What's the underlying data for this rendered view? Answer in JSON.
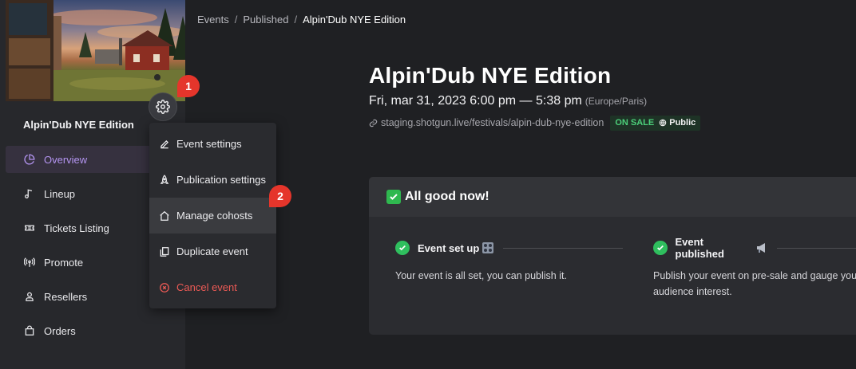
{
  "breadcrumb": {
    "items": [
      "Events",
      "Published"
    ],
    "separator": "/",
    "current": "Alpin'Dub NYE Edition"
  },
  "event": {
    "name": "Alpin'Dub NYE Edition",
    "title": "Alpin'Dub NYE Edition",
    "date": "Fri, mar 31, 2023 6:00 pm — 5:38 pm",
    "timezone": "(Europe/Paris)",
    "url": "staging.shotgun.live/festivals/alpin-dub-nye-edition",
    "status_label": "ON SALE",
    "visibility_label": "Public"
  },
  "sidebar": {
    "items": [
      {
        "label": "Overview",
        "icon": "pie-chart-icon",
        "active": true
      },
      {
        "label": "Lineup",
        "icon": "music-note-icon"
      },
      {
        "label": "Tickets Listing",
        "icon": "ticket-icon"
      },
      {
        "label": "Promote",
        "icon": "broadcast-icon"
      },
      {
        "label": "Resellers",
        "icon": "person-badge-icon"
      },
      {
        "label": "Orders",
        "icon": "shopping-bag-icon"
      }
    ]
  },
  "menu": {
    "items": [
      {
        "label": "Event settings",
        "icon": "pencil-icon"
      },
      {
        "label": "Publication settings",
        "icon": "rocket-icon"
      },
      {
        "label": "Manage cohosts",
        "icon": "home-icon"
      },
      {
        "label": "Duplicate event",
        "icon": "copy-icon"
      },
      {
        "label": "Cancel event",
        "icon": "cancel-circle-icon"
      }
    ]
  },
  "annotations": {
    "one": "1",
    "two": "2"
  },
  "card": {
    "header": "All good now!",
    "steps": [
      {
        "title": "Event set up",
        "text": "Your event is all set, you can publish it."
      },
      {
        "title": "Event published",
        "text": "Publish your event on pre-sale and gauge your audience interest."
      }
    ]
  },
  "colors": {
    "accent": "#b394f0",
    "danger": "#ec5a55",
    "success": "#2fbf5e",
    "annotation": "#e5352b"
  }
}
